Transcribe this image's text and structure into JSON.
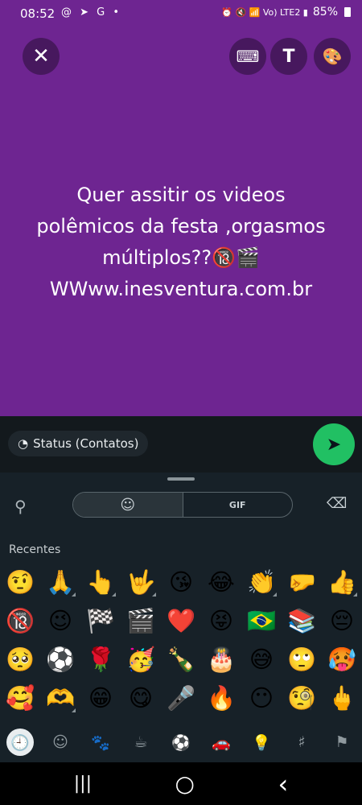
{
  "status_bar": {
    "time": "08:52",
    "left_icons": "@ ➤ G •",
    "right_icons": "⏰ 🔇 📶 Vo) LTE2 ▮",
    "battery": "85%"
  },
  "editor": {
    "close_icon": "✕",
    "keyboard_icon": "⌨",
    "text_icon": "T",
    "palette_icon": "🎨",
    "status_text": "Quer assitir os videos\npolêmicos da festa ,orgasmos\nmúltiplos??🔞🎬\nWWww.inesventura.com.br",
    "background_color": "#6e2591"
  },
  "composer": {
    "audience_icon": "◔",
    "audience_label": "Status (Contatos)",
    "send_icon": "➤"
  },
  "keyboard": {
    "search_icon": "⚲",
    "tab_emoji_icon": "☺",
    "tab_gif_label": "GIF",
    "backspace_icon": "⌫",
    "recents_label": "Recentes",
    "emojis": [
      "🤨",
      "🙏",
      "👆",
      "🤟",
      "😘",
      "😂",
      "👏",
      "🤛",
      "👍",
      "🔞",
      "😉",
      "🏁",
      "🎬",
      "❤️",
      "😝",
      "🇧🇷",
      "📚",
      "😔",
      "🥺",
      "⚽",
      "🌹",
      "🥳",
      "🍾",
      "🎂",
      "😅",
      "🙄",
      "🥵",
      "🥰",
      "🫶",
      "😁",
      "😋",
      "🎤",
      "🔥",
      "😶",
      "🧐",
      "🖕"
    ],
    "categories": [
      "🕘",
      "☺",
      "🐾",
      "☕",
      "⚽",
      "🚗",
      "💡",
      "♯",
      "⚑"
    ]
  },
  "nav": {
    "recents_icon": "|||",
    "home_icon": "○",
    "back_icon": "‹"
  }
}
